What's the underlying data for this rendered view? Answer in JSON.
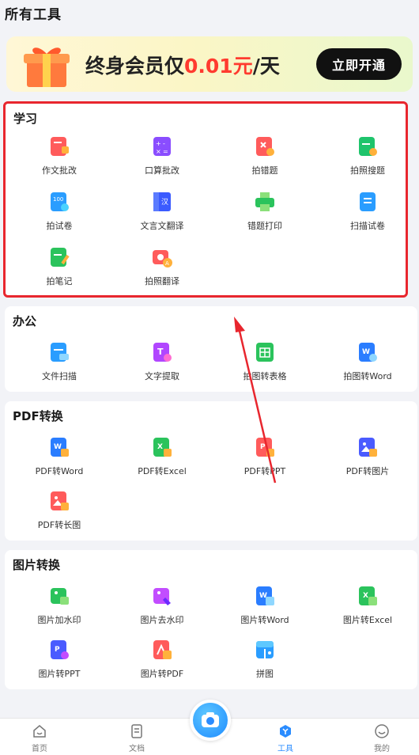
{
  "page_title": "所有工具",
  "banner": {
    "text_prefix": "终身会员仅",
    "price": "0.01元",
    "text_suffix": "/天",
    "button": "立即开通"
  },
  "sections": {
    "study": {
      "title": "学习",
      "items": [
        "作文批改",
        "口算批改",
        "拍错题",
        "拍照搜题",
        "拍试卷",
        "文言文翻译",
        "错题打印",
        "扫描试卷",
        "拍笔记",
        "拍照翻译"
      ]
    },
    "office": {
      "title": "办公",
      "items": [
        "文件扫描",
        "文字提取",
        "拍图转表格",
        "拍图转Word"
      ]
    },
    "pdf": {
      "title": "PDF转换",
      "items": [
        "PDF转Word",
        "PDF转Excel",
        "PDF转PPT",
        "PDF转图片",
        "PDF转长图"
      ]
    },
    "image": {
      "title": "图片转换",
      "items": [
        "图片加水印",
        "图片去水印",
        "图片转Word",
        "图片转Excel",
        "图片转PPT",
        "图片转PDF",
        "拼图"
      ]
    }
  },
  "tabbar": {
    "home": "首页",
    "docs": "文档",
    "tools": "工具",
    "mine": "我的"
  },
  "colors": {
    "accent": "#2a8cff",
    "price": "#ff3b2f",
    "highlight_border": "#e8262e"
  }
}
